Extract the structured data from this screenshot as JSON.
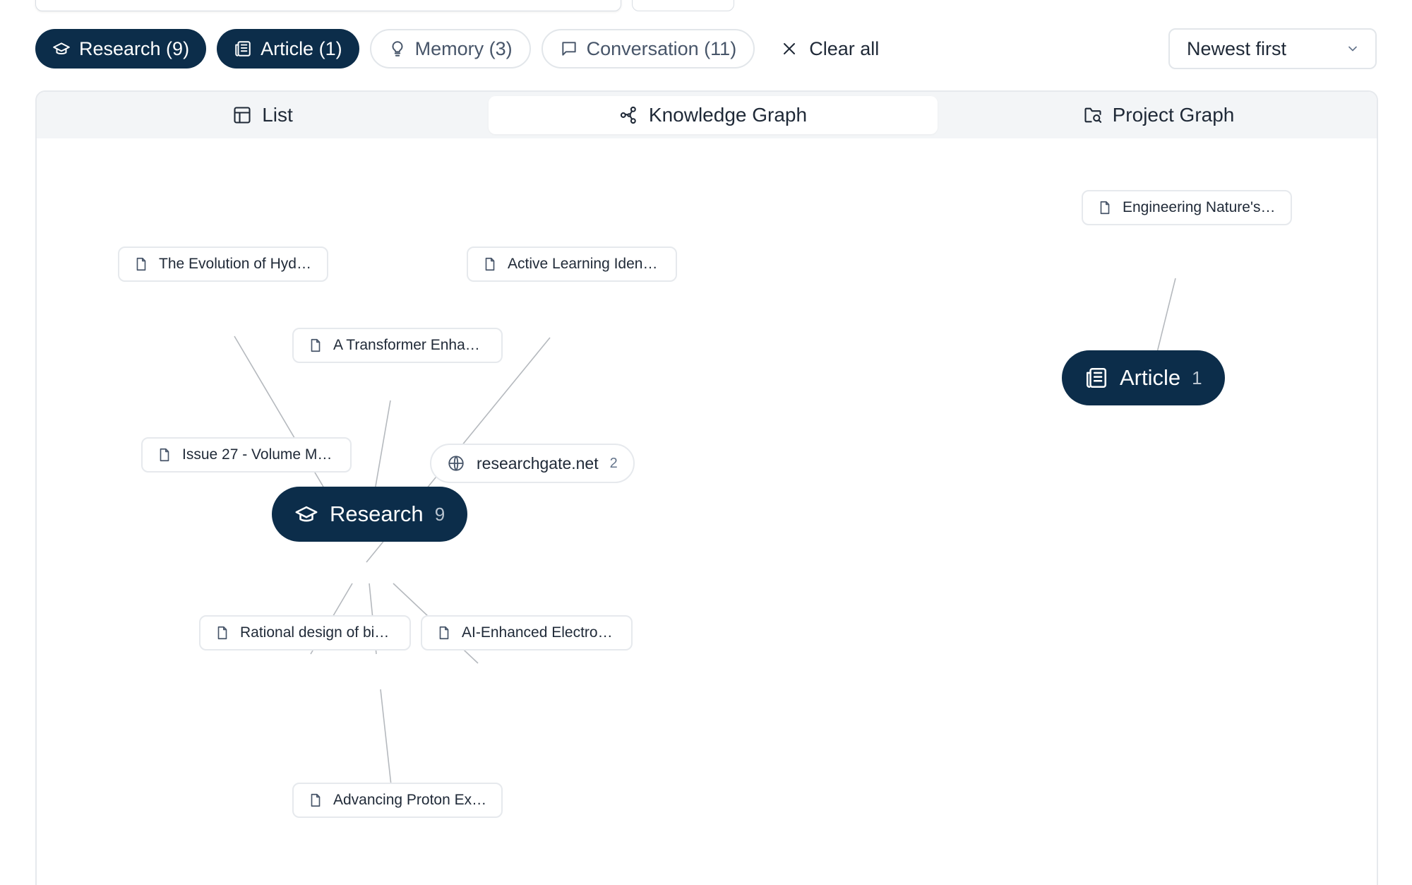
{
  "filters": [
    {
      "label": "Research (9)",
      "icon": "graduation-cap-icon",
      "active": true
    },
    {
      "label": "Article (1)",
      "icon": "newspaper-icon",
      "active": true
    },
    {
      "label": "Memory (3)",
      "icon": "lightbulb-icon",
      "active": false
    },
    {
      "label": "Conversation (11)",
      "icon": "message-square-icon",
      "active": false
    }
  ],
  "clear_all": "Clear all",
  "sort": {
    "selected": "Newest first"
  },
  "tabs": [
    {
      "label": "List",
      "icon": "table-icon"
    },
    {
      "label": "Knowledge Graph",
      "icon": "graph-nodes-icon",
      "selected": true
    },
    {
      "label": "Project Graph",
      "icon": "folder-search-icon"
    }
  ],
  "graph": {
    "hubs": {
      "research": {
        "label": "Research",
        "count": "9"
      },
      "article": {
        "label": "Article",
        "count": "1"
      }
    },
    "domain": {
      "label": "researchgate.net",
      "count": "2"
    },
    "documents": {
      "evolution": "The Evolution of Hydr…",
      "active_learning": "Active Learning Identi…",
      "transformer": "A Transformer Enhan…",
      "issue27": "Issue 27 - Volume M…",
      "rational": "Rational design of bio…",
      "ai_enhanced": "AI-Enhanced Electroc…",
      "proton": "Advancing Proton Ex…",
      "engineering": "Engineering Nature's …"
    }
  },
  "colors": {
    "hub": "#0c2d4a",
    "edge": "#b5b9be",
    "border": "#e6e9ed"
  }
}
